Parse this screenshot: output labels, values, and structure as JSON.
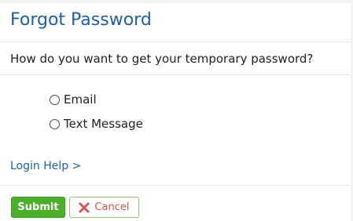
{
  "form": {
    "title": "Forgot Password",
    "question": "How do you want to get your temporary password?",
    "options": [
      {
        "label": "Email",
        "selected": false
      },
      {
        "label": "Text Message",
        "selected": false
      }
    ],
    "help_link": "Login Help >",
    "submit_label": "Submit",
    "cancel_label": "Cancel",
    "cancel_icon": "close-icon"
  },
  "colors": {
    "title": "#1f5fa6",
    "submit_bg": "#4caf2a",
    "cancel_text": "#d9534f",
    "cancel_border": "#8cc97a"
  }
}
